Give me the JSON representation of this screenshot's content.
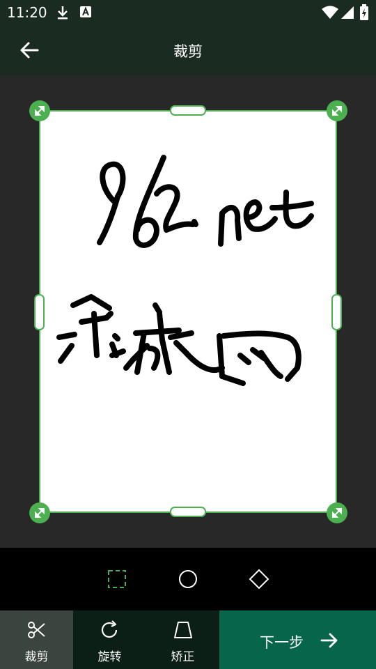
{
  "status": {
    "time": "11:20"
  },
  "header": {
    "title": "裁剪"
  },
  "image": {
    "handwriting_line1": "962.net",
    "handwriting_line2": "乐游网"
  },
  "shapes": [
    "square-crop",
    "circle-crop",
    "diamond-crop"
  ],
  "toolbar": {
    "items": [
      {
        "label": "裁剪",
        "icon": "scissors-icon",
        "active": true
      },
      {
        "label": "旋转",
        "icon": "rotate-icon",
        "active": false
      },
      {
        "label": "矫正",
        "icon": "perspective-icon",
        "active": false
      }
    ],
    "next_label": "下一步"
  },
  "colors": {
    "accent": "#4caf50",
    "header_bg": "#1a2b22",
    "next_bg": "#06654a",
    "active_tool_bg": "#3a4540"
  }
}
